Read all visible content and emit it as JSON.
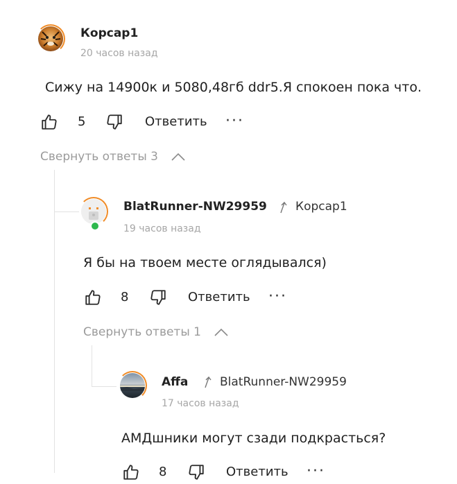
{
  "comments": [
    {
      "author": "Корсар1",
      "time": "20 часов назад",
      "text": "Сижу на 14900к и 5080,48гб ddr5.Я спокоен пока что.",
      "likes": "5",
      "reply_label": "Ответить",
      "collapse_label": "Свернуть ответы 3",
      "reply_to": ""
    },
    {
      "author": "BlatRunner-NW29959",
      "time": "19 часов назад",
      "text": "Я бы на твоем месте оглядывался)",
      "likes": "8",
      "reply_label": "Ответить",
      "collapse_label": "Свернуть ответы 1",
      "reply_to": "Корсар1"
    },
    {
      "author": "Affa",
      "time": "17 часов назад",
      "text": "АМДшники могут сзади подкрасться?",
      "likes": "8",
      "reply_label": "Ответить",
      "reply_to": "BlatRunner-NW29959"
    }
  ],
  "colors": {
    "accent": "#f08c28",
    "online": "#2db84d",
    "muted": "#9b9b9b"
  }
}
